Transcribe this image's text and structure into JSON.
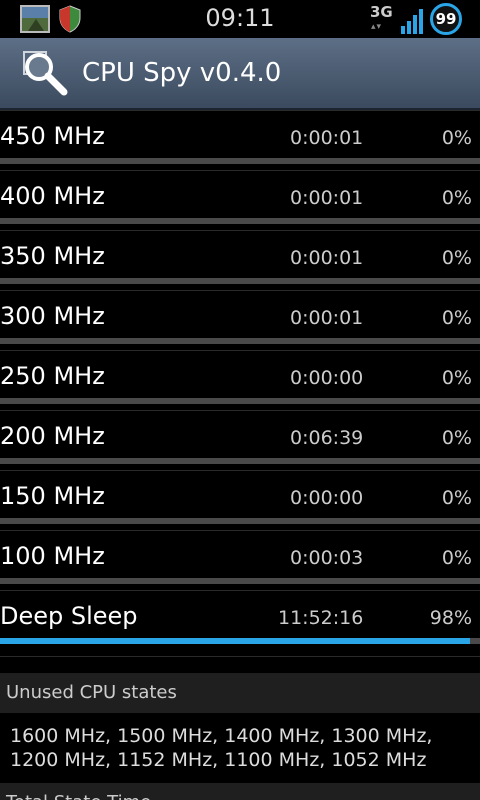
{
  "status_bar": {
    "time": "09:11",
    "network": "3G",
    "network_arrows": "▴▾",
    "battery": "99",
    "icons": [
      "gallery-icon",
      "shield-icon",
      "signal-icon",
      "battery-icon"
    ]
  },
  "app": {
    "title": "CPU Spy v0.4.0",
    "icon": "magnifier-cpu-icon"
  },
  "states": [
    {
      "freq": "450 MHz",
      "time": "0:00:01",
      "pct": "0%",
      "fraction": 0.0
    },
    {
      "freq": "400 MHz",
      "time": "0:00:01",
      "pct": "0%",
      "fraction": 0.0
    },
    {
      "freq": "350 MHz",
      "time": "0:00:01",
      "pct": "0%",
      "fraction": 0.0
    },
    {
      "freq": "300 MHz",
      "time": "0:00:01",
      "pct": "0%",
      "fraction": 0.0
    },
    {
      "freq": "250 MHz",
      "time": "0:00:00",
      "pct": "0%",
      "fraction": 0.0
    },
    {
      "freq": "200 MHz",
      "time": "0:06:39",
      "pct": "0%",
      "fraction": 0.0
    },
    {
      "freq": "150 MHz",
      "time": "0:00:00",
      "pct": "0%",
      "fraction": 0.0
    },
    {
      "freq": "100 MHz",
      "time": "0:00:03",
      "pct": "0%",
      "fraction": 0.0
    },
    {
      "freq": "Deep Sleep",
      "time": "11:52:16",
      "pct": "98%",
      "fraction": 0.98
    }
  ],
  "unused": {
    "header": "Unused CPU states",
    "line1": "1600 MHz, 1500 MHz, 1400 MHz, 1300 MHz,",
    "line2": "1200 MHz, 1152 MHz, 1100 MHz, 1052 MHz"
  },
  "total": {
    "header": "Total State Time"
  },
  "colors": {
    "accent": "#2aa6e8",
    "actionbar": "#4b5b70",
    "track": "#4a4a4a"
  }
}
